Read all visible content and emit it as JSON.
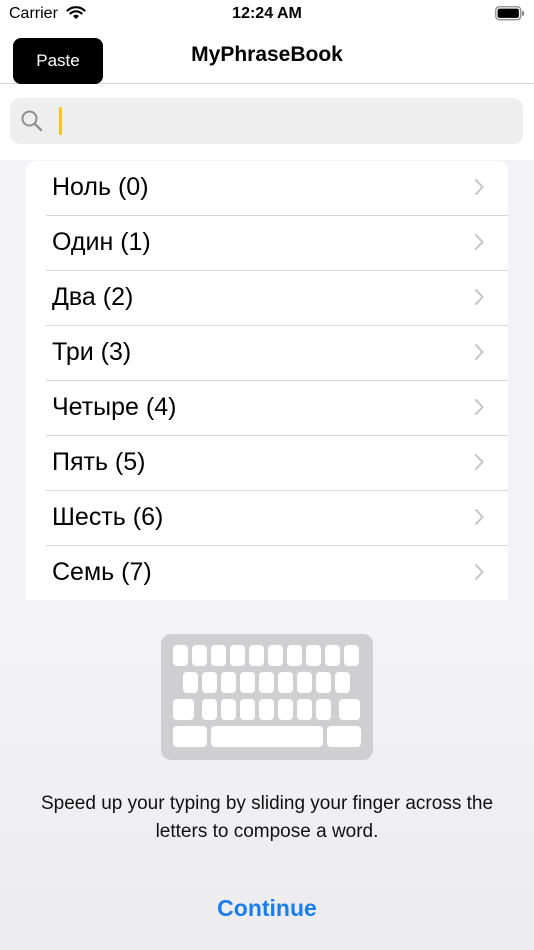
{
  "status_bar": {
    "carrier": "Carrier",
    "time": "12:24 AM"
  },
  "nav": {
    "title": "MyPhraseBook"
  },
  "tooltip": {
    "paste": "Paste"
  },
  "search": {
    "value": ""
  },
  "list": {
    "items": [
      {
        "label": "Ноль (0)"
      },
      {
        "label": "Один (1)"
      },
      {
        "label": "Два (2)"
      },
      {
        "label": "Три (3)"
      },
      {
        "label": "Четыре (4)"
      },
      {
        "label": "Пять (5)"
      },
      {
        "label": "Шесть (6)"
      },
      {
        "label": "Семь (7)"
      }
    ]
  },
  "keyboard_tip": {
    "text": "Speed up your typing by sliding your finger across the letters to compose a word.",
    "continue_label": "Continue"
  },
  "colors": {
    "accent": "#1a7ef0",
    "caret": "#f5c518"
  }
}
